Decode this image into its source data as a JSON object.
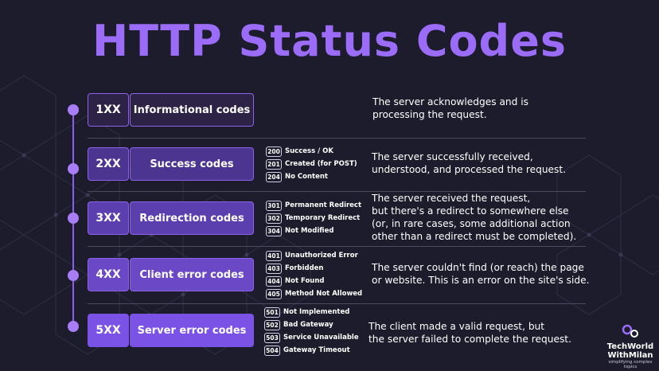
{
  "title": "HTTP Status Codes",
  "colors": {
    "background": "#1c1c2c",
    "accent": "#9b6cf7",
    "timeline": "#8a5cf0"
  },
  "rows": [
    {
      "code": "1XX",
      "name": "Informational codes",
      "examples": [],
      "description_lines": [
        "The server acknowledges and is",
        "processing the request."
      ]
    },
    {
      "code": "2XX",
      "name": "Success codes",
      "examples": [
        {
          "num": "200",
          "label": "Success / OK"
        },
        {
          "num": "201",
          "label": "Created (for POST)"
        },
        {
          "num": "204",
          "label": "No Content"
        }
      ],
      "description_lines": [
        "The server successfully received,",
        "understood, and processed the request."
      ]
    },
    {
      "code": "3XX",
      "name": "Redirection codes",
      "examples": [
        {
          "num": "301",
          "label": "Permanent Redirect"
        },
        {
          "num": "302",
          "label": "Temporary Redirect"
        },
        {
          "num": "304",
          "label": "Not Modified"
        }
      ],
      "description_lines": [
        "The server received the request,",
        "but there's a redirect to somewhere else",
        "(or, in rare cases, some additional action",
        "other than a redirect must be completed)."
      ]
    },
    {
      "code": "4XX",
      "name": "Client error codes",
      "examples": [
        {
          "num": "401",
          "label": "Unauthorized Error"
        },
        {
          "num": "403",
          "label": "Forbidden"
        },
        {
          "num": "404",
          "label": "Not Found"
        },
        {
          "num": "405",
          "label": "Method Not Allowed"
        }
      ],
      "description_lines": [
        "The server couldn't find (or reach) the page",
        "or website. This is an error on the site's side."
      ]
    },
    {
      "code": "5XX",
      "name": "Server error codes",
      "examples": [
        {
          "num": "501",
          "label": "Not Implemented"
        },
        {
          "num": "502",
          "label": "Bad Gateway"
        },
        {
          "num": "503",
          "label": "Service Unavailable"
        },
        {
          "num": "504",
          "label": "Gateway Timeout"
        }
      ],
      "description_lines": [
        "The client made a valid request, but",
        "the server failed to complete the request."
      ]
    }
  ],
  "logo": {
    "line1": "TechWorld",
    "line2": "WithMilan",
    "tagline": "simplifying complex topics",
    "icon": "gear-logo-icon"
  }
}
